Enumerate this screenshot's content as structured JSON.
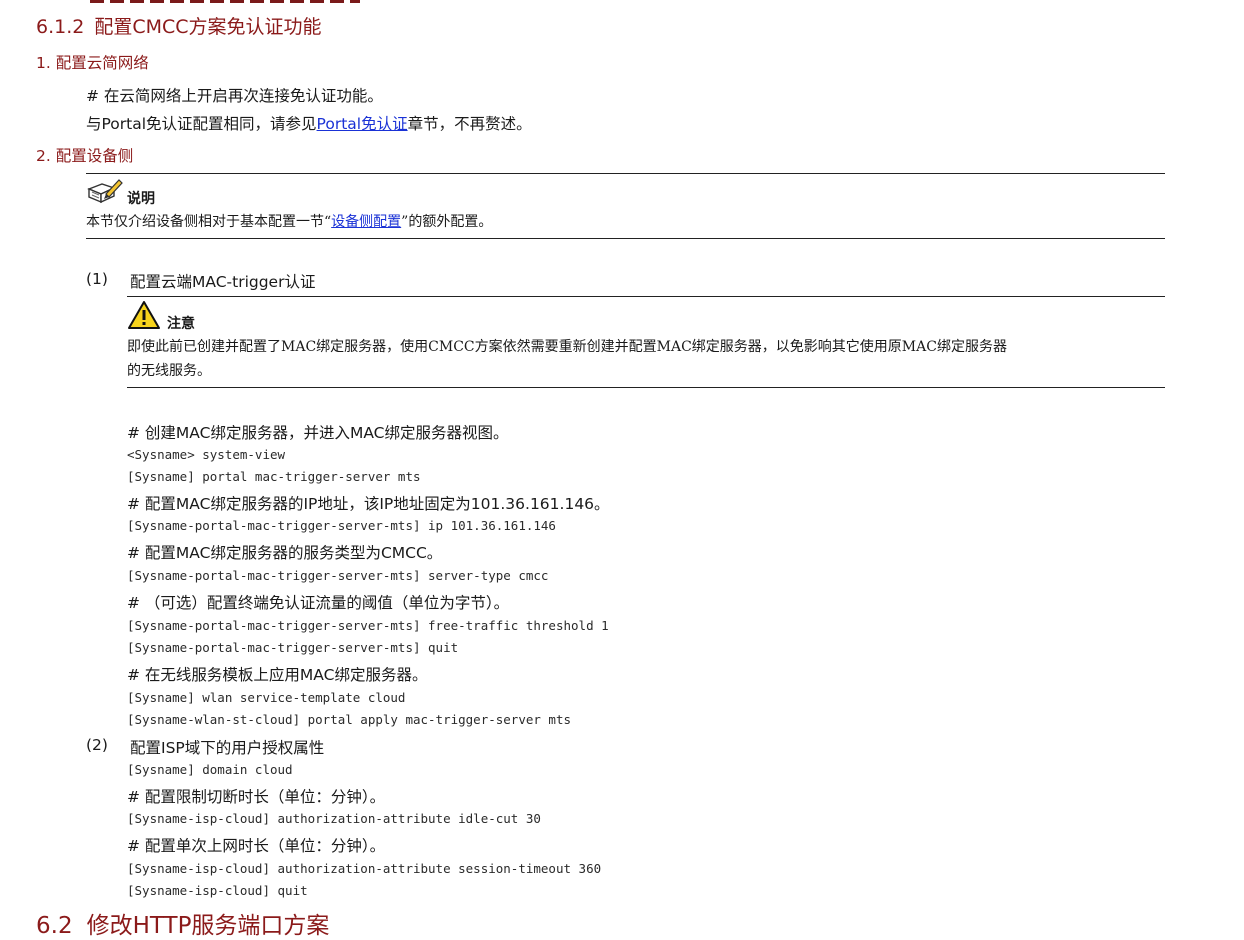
{
  "heading_613": {
    "num": "6.1.2",
    "title": "配置CMCC方案免认证功能"
  },
  "sec1": {
    "title": "1. 配置云简网络"
  },
  "sec1_line1": "# 在云简网络上开启再次连接免认证功能。",
  "sec1_line2": {
    "before": "与Portal免认证配置相同，请参见",
    "link": "Portal免认证",
    "after": "章节，不再赘述。"
  },
  "sec2": {
    "title": "2. 配置设备侧"
  },
  "note1": {
    "label": "说明",
    "before": "本节仅介绍设备侧相对于基本配置一节“",
    "link": "设备侧配置",
    "after": "”的额外配置。"
  },
  "step1": {
    "num": "(1)",
    "title": "配置云端MAC-trigger认证"
  },
  "caution": {
    "label": "注意",
    "line1": "即使此前已创建并配置了MAC绑定服务器，使用CMCC方案依然需要重新创建并配置MAC绑定服务器，以免影响其它使用原MAC绑定服务器",
    "line2": "的无线服务。"
  },
  "lines": [
    {
      "kind": "text",
      "text": "# 创建MAC绑定服务器，并进入MAC绑定服务器视图。"
    },
    {
      "kind": "code",
      "text": "<Sysname> system-view"
    },
    {
      "kind": "code",
      "text": "[Sysname] portal mac-trigger-server mts"
    },
    {
      "kind": "text",
      "text": "# 配置MAC绑定服务器的IP地址，该IP地址固定为101.36.161.146。"
    },
    {
      "kind": "code",
      "text": "[Sysname-portal-mac-trigger-server-mts] ip 101.36.161.146"
    },
    {
      "kind": "text",
      "text": "# 配置MAC绑定服务器的服务类型为CMCC。"
    },
    {
      "kind": "code",
      "text": "[Sysname-portal-mac-trigger-server-mts] server-type cmcc"
    },
    {
      "kind": "text",
      "text": "# （可选）配置终端免认证流量的阈值（单位为字节）。"
    },
    {
      "kind": "code",
      "text": "[Sysname-portal-mac-trigger-server-mts] free-traffic threshold 1"
    },
    {
      "kind": "code",
      "text": "[Sysname-portal-mac-trigger-server-mts] quit"
    },
    {
      "kind": "text",
      "text": "# 在无线服务模板上应用MAC绑定服务器。"
    },
    {
      "kind": "code",
      "text": "[Sysname] wlan service-template cloud"
    },
    {
      "kind": "code",
      "text": "[Sysname-wlan-st-cloud] portal apply mac-trigger-server mts"
    }
  ],
  "step2": {
    "num": "(2)",
    "title": "配置ISP域下的用户授权属性"
  },
  "lines2": [
    {
      "kind": "code",
      "text": "[Sysname] domain cloud"
    },
    {
      "kind": "text",
      "text": "# 配置限制切断时长（单位：分钟）。"
    },
    {
      "kind": "code",
      "text": "[Sysname-isp-cloud] authorization-attribute idle-cut 30"
    },
    {
      "kind": "text",
      "text": "# 配置单次上网时长（单位：分钟）。"
    },
    {
      "kind": "code",
      "text": "[Sysname-isp-cloud] authorization-attribute session-timeout 360"
    },
    {
      "kind": "code",
      "text": "[Sysname-isp-cloud] quit"
    }
  ],
  "heading_62": {
    "num": "6.2",
    "title": "修改HTTP服务端口方案"
  },
  "icons": {
    "note": "note-pencil-icon",
    "caution": "warning-triangle-icon"
  },
  "colors": {
    "heading": "#8b1a1a",
    "link": "#1a32d6",
    "text": "#1a1a1a"
  }
}
